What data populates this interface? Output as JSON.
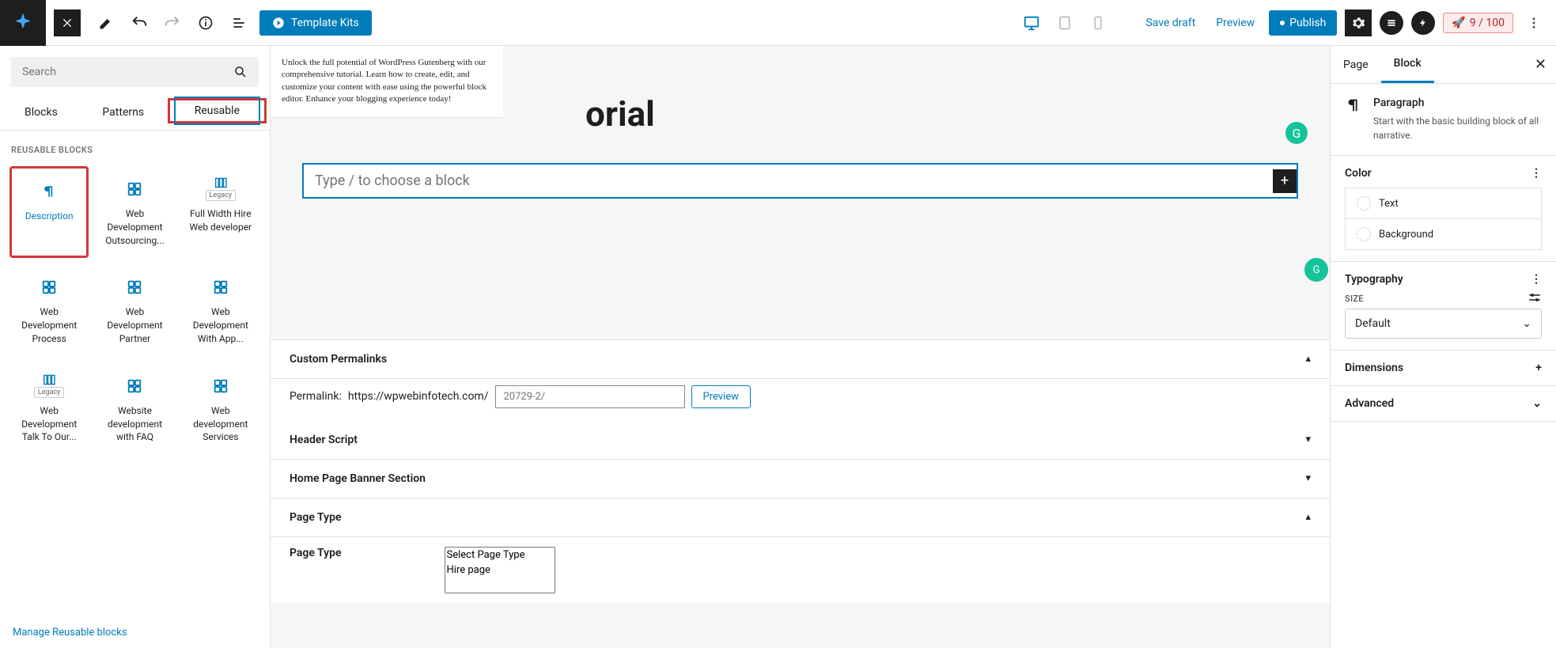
{
  "topbar": {
    "template_kits": "Template Kits",
    "save_draft": "Save draft",
    "preview": "Preview",
    "publish": "Publish",
    "score": "9 / 100"
  },
  "inserter": {
    "search_placeholder": "Search",
    "tabs": {
      "blocks": "Blocks",
      "patterns": "Patterns",
      "reusable": "Reusable"
    },
    "section_label": "REUSABLE BLOCKS",
    "blocks": [
      {
        "label": "Description",
        "icon": "paragraph"
      },
      {
        "label": "Web Development Outsourcing...",
        "icon": "group"
      },
      {
        "label": "Full Width Hire Web developer",
        "icon": "columns",
        "legacy": "Legacy"
      },
      {
        "label": "Web Development Process",
        "icon": "group"
      },
      {
        "label": "Web Development Partner",
        "icon": "group"
      },
      {
        "label": "Web Development With App...",
        "icon": "group"
      },
      {
        "label": "Web Development Talk To Our...",
        "icon": "columns",
        "legacy": "Legacy"
      },
      {
        "label": "Website development with FAQ",
        "icon": "group"
      },
      {
        "label": "Web development Services",
        "icon": "group"
      }
    ],
    "manage_link": "Manage Reusable blocks"
  },
  "canvas": {
    "preview_text": "Unlock the full potential of WordPress Gutenberg with our comprehensive tutorial. Learn how to create, edit, and customize your content with ease using the powerful block editor. Enhance your blogging experience today!",
    "title_fragment": "orial",
    "block_placeholder": "Type / to choose a block",
    "meta": {
      "custom_permalinks": "Custom Permalinks",
      "permalink_label": "Permalink:",
      "permalink_base": "https://wpwebinfotech.com/",
      "permalink_placeholder": "20729-2/",
      "permalink_preview": "Preview",
      "header_script": "Header Script",
      "home_banner": "Home Page Banner Section",
      "page_type_header": "Page Type",
      "page_type_label": "Page Type",
      "page_type_options": [
        "Select Page Type",
        "Hire page"
      ]
    }
  },
  "sidebar": {
    "tabs": {
      "page": "Page",
      "block": "Block"
    },
    "block_name": "Paragraph",
    "block_desc": "Start with the basic building block of all narrative.",
    "panels": {
      "color": "Color",
      "color_text": "Text",
      "color_bg": "Background",
      "typography": "Typography",
      "size": "SIZE",
      "size_default": "Default",
      "dimensions": "Dimensions",
      "advanced": "Advanced"
    }
  }
}
